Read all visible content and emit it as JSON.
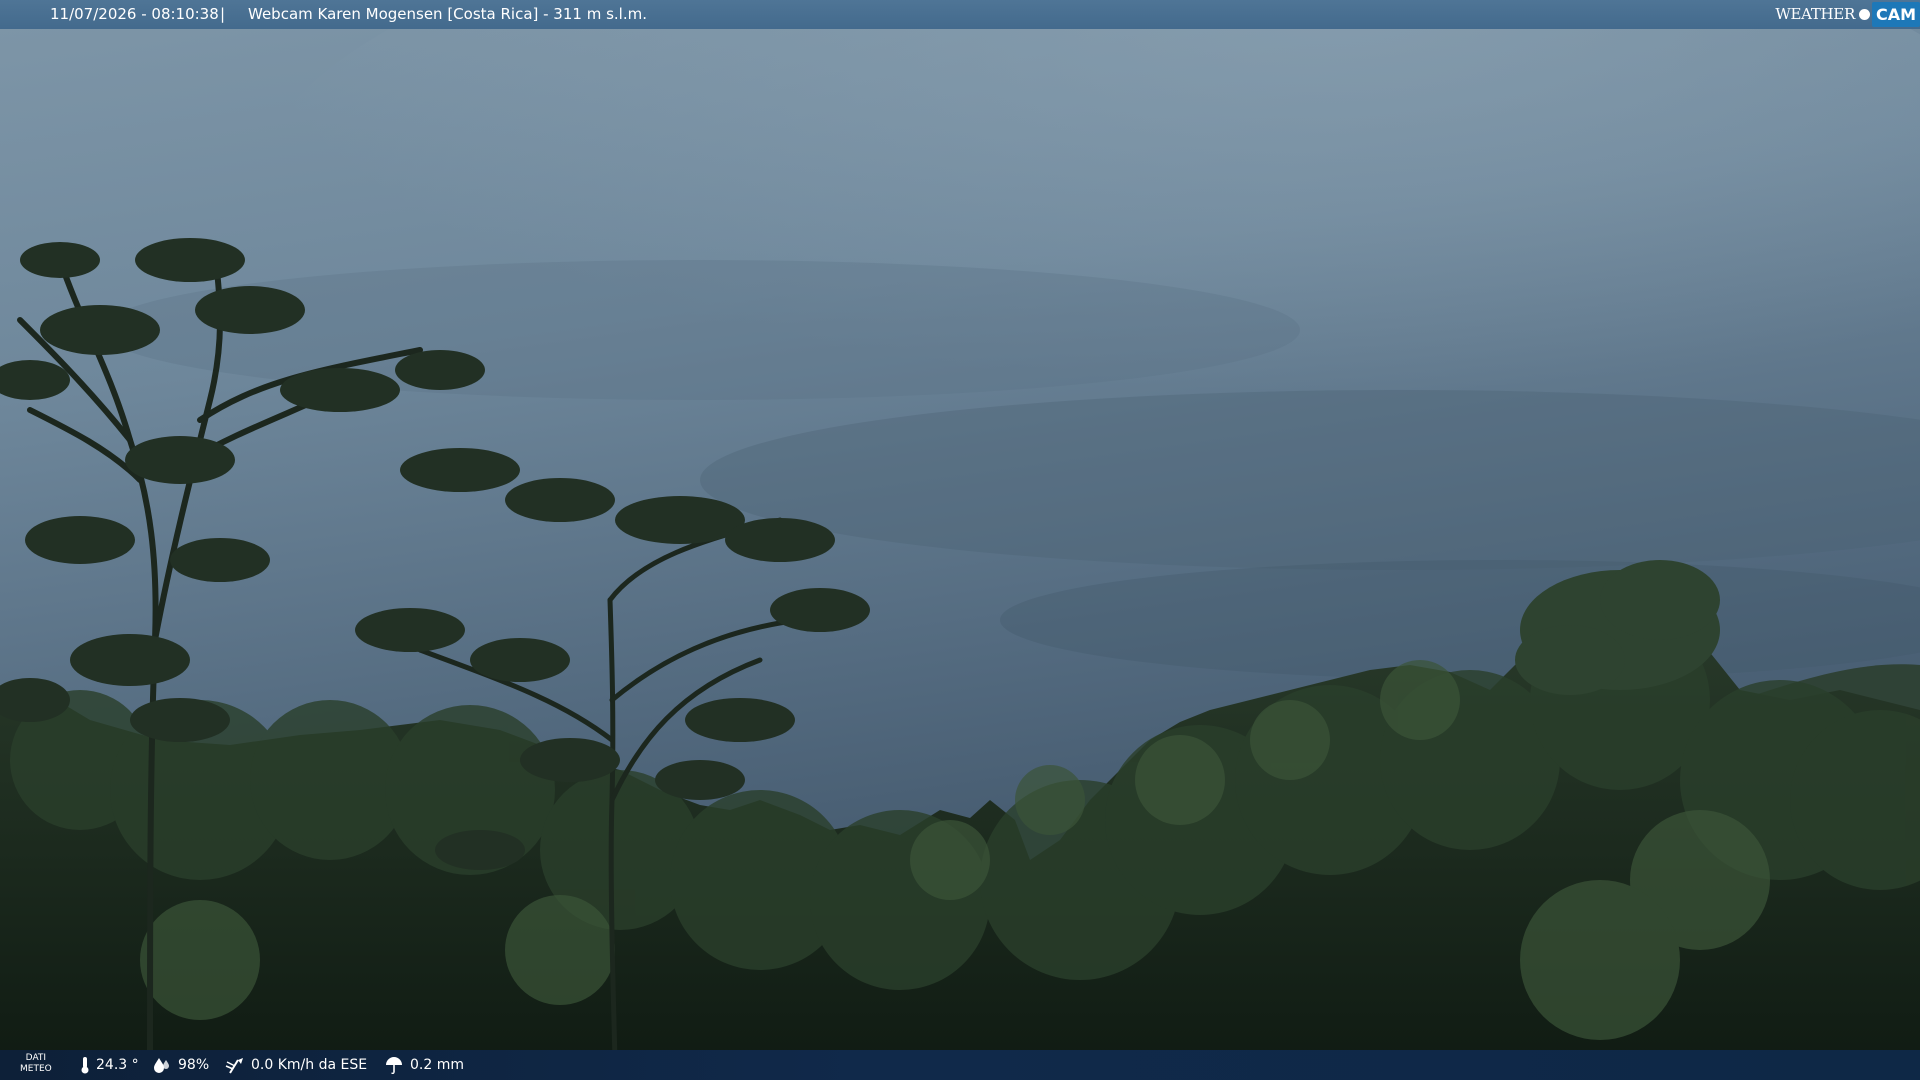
{
  "header": {
    "timestamp": "11/07/2026 - 08:10:38",
    "separator": "|",
    "title": "Webcam Karen Mogensen [Costa Rica] - 311 m s.l.m.",
    "logo_weather": "WEATHER",
    "logo_cam": "CAM"
  },
  "footer": {
    "label_line1": "DATI",
    "label_line2": "METEO",
    "temperature": "24.3 °",
    "humidity": "98%",
    "wind": "0.0 Km/h da ESE",
    "rain": "0.2 mm"
  },
  "colors": {
    "sky": "#4e6a80",
    "foliage": "#1a2a1c",
    "top_bar": "#4a7094",
    "bottom_bar": "#0f2440",
    "logo_accent": "#1d78b8"
  }
}
